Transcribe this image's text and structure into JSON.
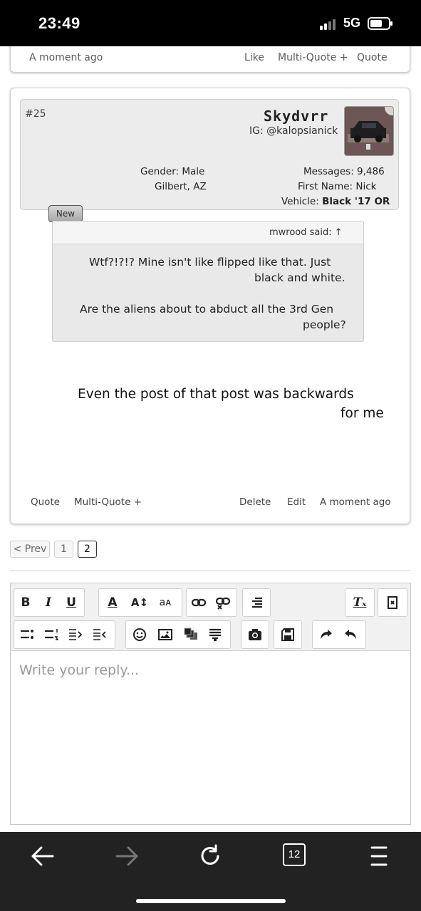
{
  "status_bar": {
    "time": "23:49",
    "network": "5G"
  },
  "prev_post_footer": {
    "timestamp": "A moment ago",
    "like": "Like",
    "multi_quote": "Multi-Quote +",
    "quote": "Quote"
  },
  "post": {
    "username": "Skydvrr",
    "instagram": "IG: @kalopsianick",
    "post_number": "#25",
    "messages_label": "Messages:",
    "messages_value": "9,486",
    "gender_label": "Gender:",
    "gender_value": "Male",
    "first_name_label": "First Name:",
    "first_name_value": "Nick",
    "location": "Gilbert, AZ",
    "vehicle_label": "Vehicle:",
    "vehicle_value": "Black '17 OR",
    "new_badge": "New",
    "quote": {
      "author": "mwrood said: ↑",
      "line1": "Wtf?!?!? Mine isn't like flipped like that. Just",
      "line2": "black and white.",
      "line3": "Are the aliens about to abduct all the 3rd Gen",
      "line4": "people?"
    },
    "message_line1": "Even the post of that post was backwards",
    "message_line2": "for me",
    "footer": {
      "timestamp": "A moment ago",
      "edit": "Edit",
      "delete": "Delete",
      "multi_quote": "Multi-Quote +",
      "quote": "Quote"
    }
  },
  "pagination": {
    "prev": "< Prev",
    "pages": [
      "1",
      "2"
    ],
    "current": "2"
  },
  "editor": {
    "placeholder": "Write your reply...",
    "toolbar_labels": {
      "bold": "B",
      "italic": "I",
      "underline": "U",
      "text_color": "A",
      "font_size": "A↕",
      "font_family": "aᴀ",
      "clear_format": "Tₓ"
    }
  },
  "browser": {
    "tab_count": "12"
  }
}
